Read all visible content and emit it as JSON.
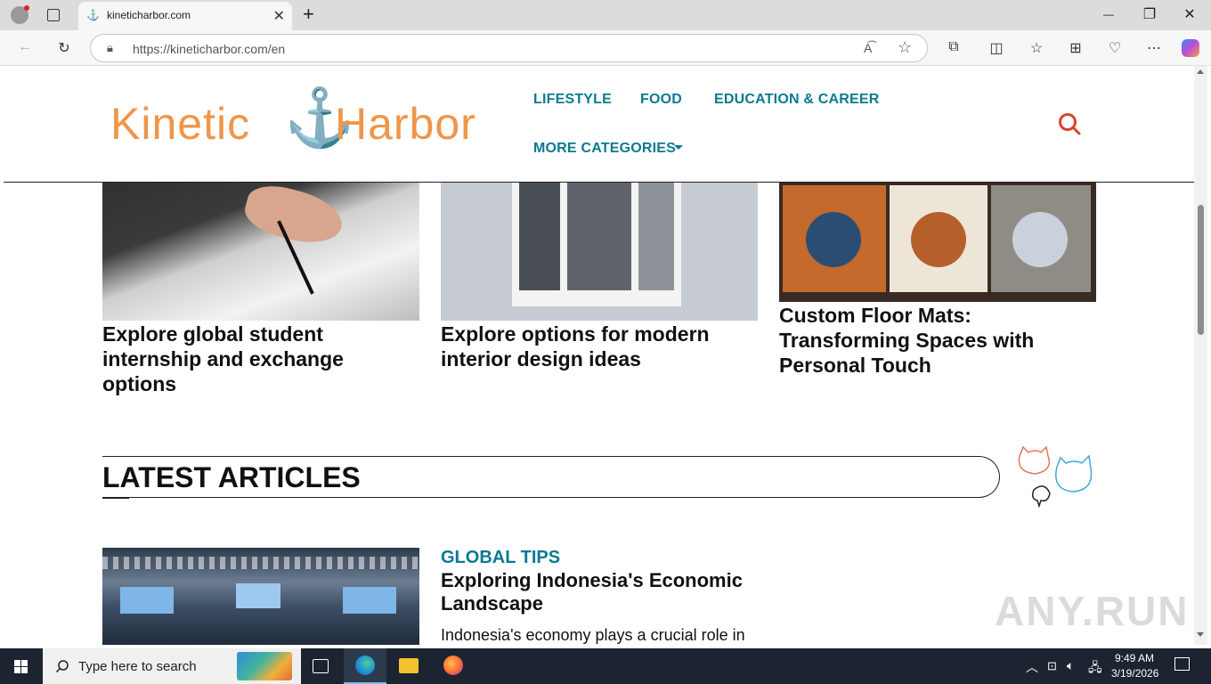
{
  "browser": {
    "tab_title": "kineticharbor.com",
    "tab_close": "✕",
    "new_tab": "+",
    "url": "https://kineticharbor.com/en",
    "window_controls": {
      "minimize": "—",
      "maximize": "❐",
      "close": "✕"
    }
  },
  "site": {
    "logo_left": "Kinetic",
    "logo_right": "Harbor",
    "nav": {
      "lifestyle": "LIFESTYLE",
      "food": "FOOD",
      "education": "EDUCATION & CAREER",
      "more": "MORE CATEGORIES"
    }
  },
  "cards": [
    {
      "title": "Explore global student internship and exchange options"
    },
    {
      "title": "Explore options for modern interior design ideas"
    },
    {
      "title": "Custom Floor Mats: Transforming Spaces with Personal Touch"
    }
  ],
  "latest": {
    "heading": "LATEST ARTICLES",
    "article": {
      "category": "GLOBAL TIPS",
      "title": "Exploring Indonesia's Economic Landscape",
      "excerpt": "Indonesia's economy plays a crucial role in"
    }
  },
  "watermark": "ANY.RUN",
  "taskbar": {
    "search_placeholder": "Type here to search",
    "time": "9:49 AM",
    "date": "3/19/2026"
  },
  "colors": {
    "nav_teal": "#0b7a90",
    "logo_orange": "#f0954a",
    "anchor_blue": "#2a87c9",
    "search_red": "#d9452b"
  }
}
